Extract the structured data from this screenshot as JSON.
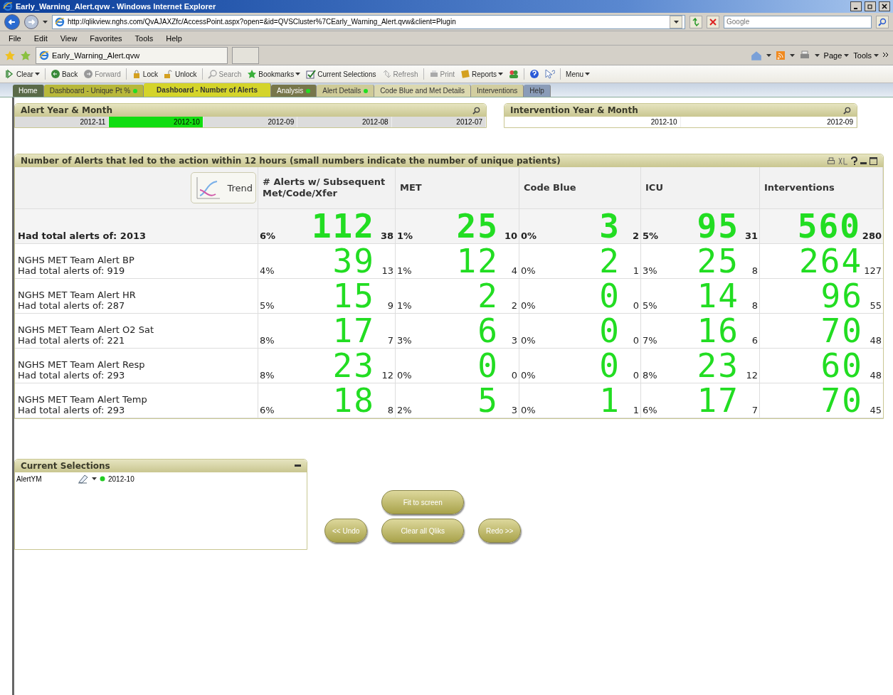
{
  "window": {
    "title": "Early_Warning_Alert.qvw - Windows Internet Explorer"
  },
  "address_bar": {
    "url": "http://qlikview.nghs.com/QvAJAXZfc/AccessPoint.aspx?open=&id=QVSCluster%7CEarly_Warning_Alert.qvw&client=Plugin",
    "search_placeholder": "Google"
  },
  "menu_bar": [
    "File",
    "Edit",
    "View",
    "Favorites",
    "Tools",
    "Help"
  ],
  "browser_tab": {
    "title": "Early_Warning_Alert.qvw"
  },
  "command_bar": [
    {
      "label": "Page"
    },
    {
      "label": "Tools"
    }
  ],
  "qlik_toolbar": [
    {
      "kind": "clear",
      "label": "Clear",
      "disabled": false,
      "dropdown": true
    },
    {
      "kind": "back",
      "label": "Back",
      "disabled": false,
      "dropdown": false
    },
    {
      "kind": "forward",
      "label": "Forward",
      "disabled": true,
      "dropdown": false
    },
    {
      "kind": "lock",
      "label": "Lock",
      "disabled": false,
      "dropdown": false
    },
    {
      "kind": "unlock",
      "label": "Unlock",
      "disabled": false,
      "dropdown": false
    },
    {
      "kind": "search",
      "label": "Search",
      "disabled": true,
      "dropdown": false
    },
    {
      "kind": "bookmarks",
      "label": "Bookmarks",
      "disabled": false,
      "dropdown": true
    },
    {
      "kind": "selections",
      "label": "Current Selections",
      "disabled": false,
      "dropdown": false
    },
    {
      "kind": "refresh",
      "label": "Refresh",
      "disabled": true,
      "dropdown": false
    },
    {
      "kind": "print",
      "label": "Print",
      "disabled": true,
      "dropdown": false
    },
    {
      "kind": "reports",
      "label": "Reports",
      "disabled": false,
      "dropdown": true
    },
    {
      "kind": "users",
      "disabled": false,
      "dropdown": false
    },
    {
      "kind": "help",
      "disabled": false,
      "dropdown": false
    },
    {
      "kind": "whatsthis",
      "disabled": false,
      "dropdown": false
    },
    {
      "kind": "menu",
      "label": "Menu",
      "disabled": false,
      "dropdown": true
    }
  ],
  "sheet_tabs": [
    {
      "label": "Home",
      "selected": false,
      "dot": false,
      "color": "#5a6a48"
    },
    {
      "label": "Dashboard - Unique Pt %",
      "selected": false,
      "dot": true,
      "color": "#b8b83a"
    },
    {
      "label": "Dashboard - Number of Alerts",
      "selected": true,
      "dot": false,
      "color": "#d4d42a"
    },
    {
      "label": "Analysis",
      "selected": false,
      "dot": true,
      "color": "#77764a"
    },
    {
      "label": "Alert Details",
      "selected": false,
      "dot": true,
      "color": "#cfcb98"
    },
    {
      "label": "Code Blue and Met Details",
      "selected": false,
      "dot": false,
      "color": "#dcd9b0"
    },
    {
      "label": "Interventions",
      "selected": false,
      "dot": false,
      "color": "#d2cea0"
    },
    {
      "label": "Help",
      "selected": false,
      "dot": false,
      "color": "#8a9cb8"
    }
  ],
  "listboxes": [
    {
      "title": "Alert Year & Month",
      "items": [
        {
          "label": "2012-11",
          "selected": false,
          "excluded": true
        },
        {
          "label": "2012-10",
          "selected": true,
          "excluded": false
        },
        {
          "label": "2012-09",
          "selected": false,
          "excluded": true
        },
        {
          "label": "2012-08",
          "selected": false,
          "excluded": true
        },
        {
          "label": "2012-07",
          "selected": false,
          "excluded": true
        }
      ]
    },
    {
      "title": "Intervention Year & Month",
      "items": [
        {
          "label": "2012-10",
          "selected": false,
          "excluded": false
        },
        {
          "label": "2012-09",
          "selected": false,
          "excluded": false
        }
      ]
    }
  ],
  "table": {
    "title": "Number of Alerts that led to the action within 12 hours (small numbers indicate the number of unique patients)",
    "trend_button": "Trend",
    "columns": [
      "# Alerts w/ Subsequent Met/Code/Xfer",
      "MET",
      "Code Blue",
      "ICU",
      "Interventions"
    ],
    "rows": [
      {
        "kind": "total",
        "total": "Had total alerts of: 2013",
        "cells": [
          {
            "pct": "6%",
            "value": "112",
            "unique": "38"
          },
          {
            "pct": "1%",
            "value": "25",
            "unique": "10"
          },
          {
            "pct": "0%",
            "value": "3",
            "unique": "2"
          },
          {
            "pct": "5%",
            "value": "95",
            "unique": "31"
          },
          {
            "value": "560",
            "unique": "280"
          }
        ]
      },
      {
        "kind": "alert",
        "name": "NGHS MET Team Alert BP",
        "total": "Had total alerts of: 919",
        "cells": [
          {
            "pct": "4%",
            "value": "39",
            "unique": "13"
          },
          {
            "pct": "1%",
            "value": "12",
            "unique": "4"
          },
          {
            "pct": "0%",
            "value": "2",
            "unique": "1"
          },
          {
            "pct": "3%",
            "value": "25",
            "unique": "8"
          },
          {
            "value": "264",
            "unique": "127"
          }
        ]
      },
      {
        "kind": "alert",
        "name": "NGHS MET Team Alert HR",
        "total": "Had total alerts of: 287",
        "cells": [
          {
            "pct": "5%",
            "value": "15",
            "unique": "9"
          },
          {
            "pct": "1%",
            "value": "2",
            "unique": "2"
          },
          {
            "pct": "0%",
            "value": "0",
            "unique": "0"
          },
          {
            "pct": "5%",
            "value": "14",
            "unique": "8"
          },
          {
            "value": "96",
            "unique": "55"
          }
        ]
      },
      {
        "kind": "alert",
        "name": "NGHS MET Team Alert O2 Sat",
        "total": "Had total alerts of: 221",
        "cells": [
          {
            "pct": "8%",
            "value": "17",
            "unique": "7"
          },
          {
            "pct": "3%",
            "value": "6",
            "unique": "3"
          },
          {
            "pct": "0%",
            "value": "0",
            "unique": "0"
          },
          {
            "pct": "7%",
            "value": "16",
            "unique": "6"
          },
          {
            "value": "70",
            "unique": "48"
          }
        ]
      },
      {
        "kind": "alert",
        "name": "NGHS MET Team Alert Resp",
        "total": "Had total alerts of: 293",
        "cells": [
          {
            "pct": "8%",
            "value": "23",
            "unique": "12"
          },
          {
            "pct": "0%",
            "value": "0",
            "unique": "0"
          },
          {
            "pct": "0%",
            "value": "0",
            "unique": "0"
          },
          {
            "pct": "8%",
            "value": "23",
            "unique": "12"
          },
          {
            "value": "60",
            "unique": "48"
          }
        ]
      },
      {
        "kind": "alert",
        "name": "NGHS MET Team Alert Temp",
        "total": "Had total alerts of: 293",
        "cells": [
          {
            "pct": "6%",
            "value": "18",
            "unique": "8"
          },
          {
            "pct": "2%",
            "value": "5",
            "unique": "3"
          },
          {
            "pct": "0%",
            "value": "1",
            "unique": "1"
          },
          {
            "pct": "6%",
            "value": "17",
            "unique": "7"
          },
          {
            "value": "70",
            "unique": "45"
          }
        ]
      }
    ]
  },
  "current_selections": {
    "title": "Current Selections",
    "items": [
      {
        "field": "AlertYM",
        "value": "2012-10"
      }
    ]
  },
  "buttons": [
    {
      "kind": "undo",
      "label": "<< Undo"
    },
    {
      "kind": "fit",
      "label": "Fit to screen"
    },
    {
      "kind": "clear",
      "label": "Clear all Qliks"
    },
    {
      "kind": "redo",
      "label": "Redo >>"
    }
  ]
}
